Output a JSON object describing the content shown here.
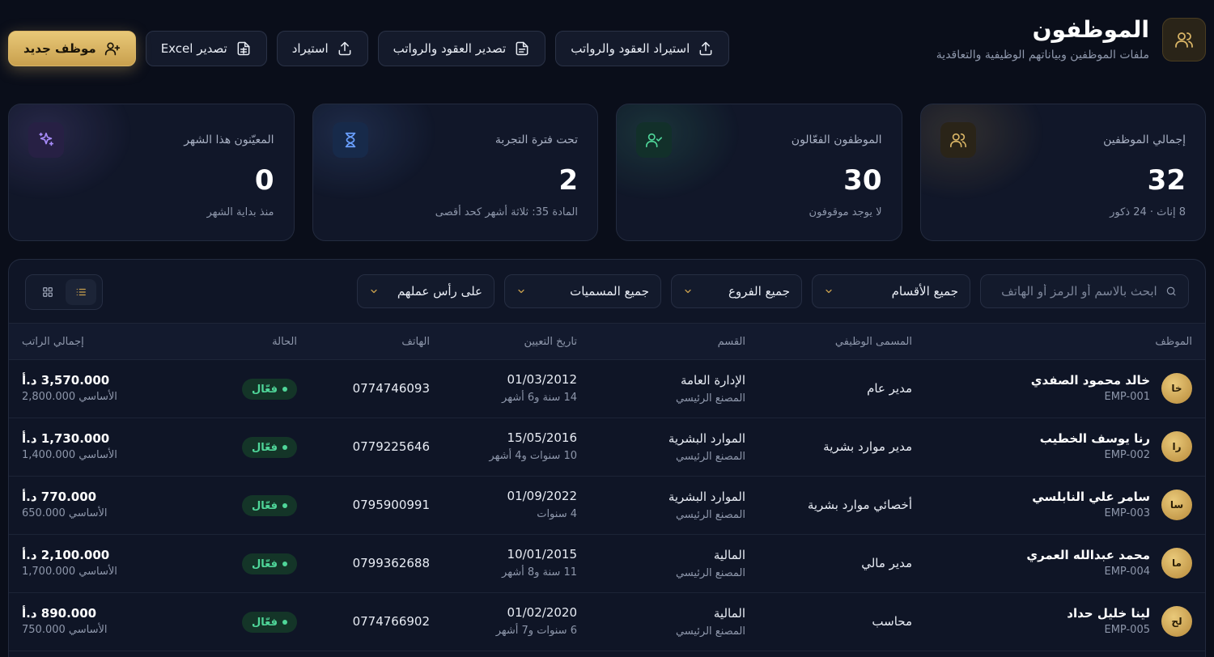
{
  "header": {
    "title": "الموظفون",
    "subtitle": "ملفات الموظفين وبياناتهم الوظيفية والتعاقدية",
    "title_icon": "users-icon"
  },
  "actions": {
    "new_employee": "موظف جديد",
    "export_excel": "تصدير Excel",
    "import": "استيراد",
    "export_contracts": "تصدير العقود والرواتب",
    "import_contracts": "استيراد العقود والرواتب"
  },
  "stats": [
    {
      "label": "إجمالي الموظفين",
      "value": "32",
      "sub": "8 إناث · 24 ذكور",
      "icon": "users-icon",
      "color": "#c9a04e"
    },
    {
      "label": "الموظفون الفعّالون",
      "value": "30",
      "sub": "لا يوجد موقوفون",
      "icon": "user-check-icon",
      "color": "#4fd699"
    },
    {
      "label": "تحت فترة التجربة",
      "value": "2",
      "sub": "المادة 35: ثلاثة أشهر كحد أقصى",
      "icon": "hourglass-icon",
      "color": "#6aa0ff"
    },
    {
      "label": "المعيّنون هذا الشهر",
      "value": "0",
      "sub": "منذ بداية الشهر",
      "icon": "sparkles-icon",
      "color": "#a78bfa"
    }
  ],
  "filters": {
    "search_placeholder": "ابحث بالاسم أو الرمز أو الهاتف",
    "department": "جميع الأقسام",
    "branch": "جميع الفروع",
    "title": "جميع المسميات",
    "status": "على رأس عملهم"
  },
  "columns": {
    "employee": "الموظف",
    "job_title": "المسمى الوظيفي",
    "department": "القسم",
    "hire_date": "تاريخ التعيين",
    "phone": "الهاتف",
    "status": "الحالة",
    "total_salary": "إجمالي الراتب"
  },
  "rows": [
    {
      "initials": "خا",
      "name": "خالد محمود الصفدي",
      "code": "EMP-001",
      "job": "مدير عام",
      "dept": "الإدارة العامة",
      "branch": "المصنع الرئيسي",
      "date": "01/03/2012",
      "tenure": "14 سنة و6 أشهر",
      "phone": "0774746093",
      "status": "فعّال",
      "salary": "3,570.000 د.أ",
      "basic": "الأساسي 2,800.000"
    },
    {
      "initials": "را",
      "name": "رنا يوسف الخطيب",
      "code": "EMP-002",
      "job": "مدير موارد بشرية",
      "dept": "الموارد البشرية",
      "branch": "المصنع الرئيسي",
      "date": "15/05/2016",
      "tenure": "10 سنوات و4 أشهر",
      "phone": "0779225646",
      "status": "فعّال",
      "salary": "1,730.000 د.أ",
      "basic": "الأساسي 1,400.000"
    },
    {
      "initials": "سا",
      "name": "سامر علي النابلسي",
      "code": "EMP-003",
      "job": "أخصائي موارد بشرية",
      "dept": "الموارد البشرية",
      "branch": "المصنع الرئيسي",
      "date": "01/09/2022",
      "tenure": "4 سنوات",
      "phone": "0795900991",
      "status": "فعّال",
      "salary": "770.000 د.أ",
      "basic": "الأساسي 650.000"
    },
    {
      "initials": "ما",
      "name": "محمد عبدالله العمري",
      "code": "EMP-004",
      "job": "مدير مالي",
      "dept": "المالية",
      "branch": "المصنع الرئيسي",
      "date": "10/01/2015",
      "tenure": "11 سنة و8 أشهر",
      "phone": "0799362688",
      "status": "فعّال",
      "salary": "2,100.000 د.أ",
      "basic": "الأساسي 1,700.000"
    },
    {
      "initials": "لح",
      "name": "لينا خليل حداد",
      "code": "EMP-005",
      "job": "محاسب",
      "dept": "المالية",
      "branch": "المصنع الرئيسي",
      "date": "01/02/2020",
      "tenure": "6 سنوات و7 أشهر",
      "phone": "0774766902",
      "status": "فعّال",
      "salary": "890.000 د.أ",
      "basic": "الأساسي 750.000"
    }
  ]
}
